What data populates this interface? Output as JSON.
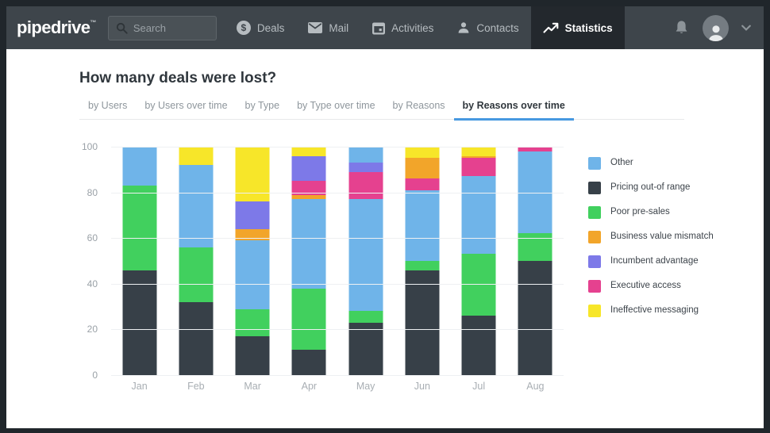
{
  "navbar": {
    "logo": "pipedrive",
    "logo_tm": "™",
    "search": {
      "placeholder": "Search"
    },
    "items": [
      {
        "label": "Deals",
        "icon": "dollar-circle-icon",
        "active": false
      },
      {
        "label": "Mail",
        "icon": "mail-icon",
        "active": false
      },
      {
        "label": "Activities",
        "icon": "calendar-icon",
        "active": false
      },
      {
        "label": "Contacts",
        "icon": "contact-icon",
        "active": false
      },
      {
        "label": "Statistics",
        "icon": "trend-icon",
        "active": true
      }
    ]
  },
  "page": {
    "title": "How many deals were lost?",
    "tabs": [
      {
        "label": "by Users",
        "active": false
      },
      {
        "label": "by Users over time",
        "active": false
      },
      {
        "label": "by Type",
        "active": false
      },
      {
        "label": "by Type over time",
        "active": false
      },
      {
        "label": "by Reasons",
        "active": false
      },
      {
        "label": "by Reasons over time",
        "active": true
      }
    ]
  },
  "legend": {
    "items": [
      {
        "key": "other",
        "label": "Other"
      },
      {
        "key": "pricing",
        "label": "Pricing out-of range"
      },
      {
        "key": "poor",
        "label": "Poor pre-sales"
      },
      {
        "key": "business",
        "label": "Business value mismatch"
      },
      {
        "key": "incumbent",
        "label": "Incumbent advantage"
      },
      {
        "key": "executive",
        "label": "Executive access"
      },
      {
        "key": "ineffective",
        "label": "Ineffective messaging"
      }
    ]
  },
  "colors": {
    "other": "#6fb4e9",
    "pricing": "#374048",
    "poor": "#41d05e",
    "business": "#f2a52a",
    "incumbent": "#7d79e8",
    "executive": "#e5418f",
    "ineffective": "#f7e629",
    "accent_underline": "#4799e0"
  },
  "chart_data": {
    "type": "bar",
    "subtype": "stacked-percent",
    "title": "How many deals were lost? — by Reasons over time",
    "xlabel": "",
    "ylabel": "",
    "ylim": [
      0,
      100
    ],
    "yticks": [
      0,
      20,
      40,
      60,
      80,
      100
    ],
    "grid": "horizontal",
    "legend_position": "right",
    "categories": [
      "Jan",
      "Feb",
      "Mar",
      "Apr",
      "May",
      "Jun",
      "Jul",
      "Aug"
    ],
    "bars": [
      {
        "month": "Jan",
        "segments": [
          {
            "reason": "pricing",
            "value": 46
          },
          {
            "reason": "poor",
            "value": 37
          },
          {
            "reason": "other",
            "value": 17
          }
        ]
      },
      {
        "month": "Feb",
        "segments": [
          {
            "reason": "pricing",
            "value": 32
          },
          {
            "reason": "poor",
            "value": 24
          },
          {
            "reason": "other",
            "value": 36
          },
          {
            "reason": "ineffective",
            "value": 8
          }
        ]
      },
      {
        "month": "Mar",
        "segments": [
          {
            "reason": "pricing",
            "value": 17
          },
          {
            "reason": "poor",
            "value": 12
          },
          {
            "reason": "other",
            "value": 30
          },
          {
            "reason": "business",
            "value": 5
          },
          {
            "reason": "incumbent",
            "value": 12
          },
          {
            "reason": "ineffective",
            "value": 24
          }
        ]
      },
      {
        "month": "Apr",
        "segments": [
          {
            "reason": "pricing",
            "value": 11
          },
          {
            "reason": "poor",
            "value": 27
          },
          {
            "reason": "other",
            "value": 39
          },
          {
            "reason": "business",
            "value": 2
          },
          {
            "reason": "executive",
            "value": 6
          },
          {
            "reason": "incumbent",
            "value": 11
          },
          {
            "reason": "ineffective",
            "value": 4
          }
        ]
      },
      {
        "month": "May",
        "segments": [
          {
            "reason": "pricing",
            "value": 23
          },
          {
            "reason": "poor",
            "value": 5
          },
          {
            "reason": "other",
            "value": 49
          },
          {
            "reason": "executive",
            "value": 12
          },
          {
            "reason": "incumbent",
            "value": 4
          },
          {
            "reason": "other",
            "value": 7
          }
        ]
      },
      {
        "month": "Jun",
        "segments": [
          {
            "reason": "pricing",
            "value": 46
          },
          {
            "reason": "poor",
            "value": 4
          },
          {
            "reason": "other",
            "value": 31
          },
          {
            "reason": "executive",
            "value": 5
          },
          {
            "reason": "business",
            "value": 9
          },
          {
            "reason": "ineffective",
            "value": 5
          }
        ]
      },
      {
        "month": "Jul",
        "segments": [
          {
            "reason": "pricing",
            "value": 26
          },
          {
            "reason": "poor",
            "value": 27
          },
          {
            "reason": "other",
            "value": 34
          },
          {
            "reason": "executive",
            "value": 8
          },
          {
            "reason": "business",
            "value": 1
          },
          {
            "reason": "ineffective",
            "value": 4
          }
        ]
      },
      {
        "month": "Aug",
        "segments": [
          {
            "reason": "pricing",
            "value": 50
          },
          {
            "reason": "poor",
            "value": 12
          },
          {
            "reason": "other",
            "value": 36
          },
          {
            "reason": "executive",
            "value": 2
          }
        ]
      }
    ]
  }
}
